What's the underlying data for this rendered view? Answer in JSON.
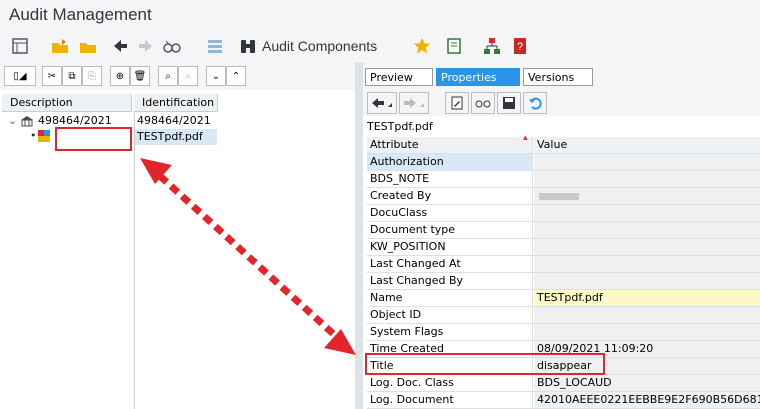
{
  "app": {
    "title": "Audit Management"
  },
  "toolbar": {
    "audit_components_label": "Audit Components"
  },
  "tree": {
    "columns": [
      "Description",
      "Identification"
    ],
    "root": {
      "description": "498464/2021",
      "identification": "498464/2021"
    },
    "child": {
      "description": "",
      "identification": "TESTpdf.pdf"
    }
  },
  "details": {
    "tabs": [
      "Preview",
      "Properties",
      "Versions"
    ],
    "active_tab": "Properties",
    "file_name": "TESTpdf.pdf",
    "columns": [
      "Attribute",
      "Value"
    ],
    "rows": [
      {
        "attr": "Authorization",
        "value": ""
      },
      {
        "attr": "BDS_NOTE",
        "value": ""
      },
      {
        "attr": "Created By",
        "value": ""
      },
      {
        "attr": "DocuClass",
        "value": ""
      },
      {
        "attr": "Document type",
        "value": ""
      },
      {
        "attr": "KW_POSITION",
        "value": ""
      },
      {
        "attr": "Last Changed At",
        "value": ""
      },
      {
        "attr": "Last Changed By",
        "value": ""
      },
      {
        "attr": "Name",
        "value": "TESTpdf.pdf"
      },
      {
        "attr": "Object ID",
        "value": ""
      },
      {
        "attr": "System Flags",
        "value": ""
      },
      {
        "attr": "Time Created",
        "value": "08/09/2021 11:09:20"
      },
      {
        "attr": "Title",
        "value": "disappear"
      },
      {
        "attr": "Log. Doc. Class",
        "value": "BDS_LOCAUD"
      },
      {
        "attr": "Log. Document",
        "value": "42010AEEE0221EEBBE9E2F690B56D681"
      }
    ]
  },
  "colors": {
    "accent": "#2a94e6",
    "highlight": "#e0262b",
    "selected_row": "#d9e8f6",
    "name_value": "#fdf8c7"
  }
}
